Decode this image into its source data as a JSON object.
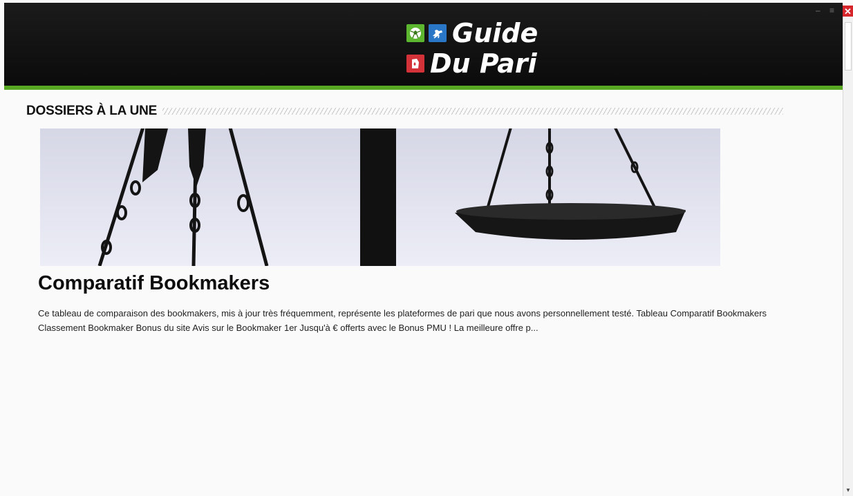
{
  "window": {
    "minimize_label": "–",
    "maximize_label": "≡",
    "close_label": "✕"
  },
  "header": {
    "logo_line1": "Guide",
    "logo_line2": "Du Pari",
    "logo_icons": [
      "soccer-ball-icon",
      "horse-racing-icon",
      "poker-card-icon"
    ],
    "colors": {
      "green": "#5cb630",
      "blue": "#2b77c7",
      "red": "#d33238",
      "accent_bar": "#58a824"
    }
  },
  "section": {
    "title": "DOSSIERS À LA UNE"
  },
  "article": {
    "title": "Comparatif Bookmakers",
    "excerpt": "Ce tableau de comparaison des bookmakers, mis à jour très fréquemment, représente les plateformes de pari que nous avons personnellement testé. Tableau Comparatif Bookmakers   Classement Bookmaker Bonus du site Avis sur le Bookmaker 1er Jusqu'à € offerts avec le Bonus PMU ! La meilleure offre p..."
  }
}
